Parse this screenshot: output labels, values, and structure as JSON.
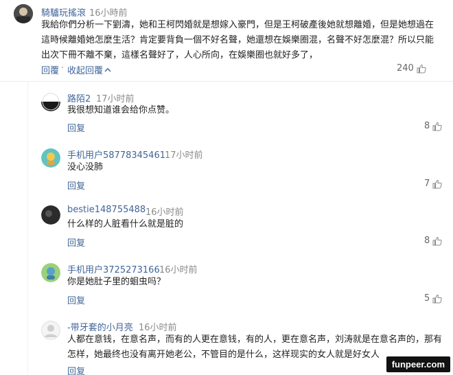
{
  "top_comment": {
    "username": "騎驢玩搖滾",
    "time": "16小時前",
    "text": "我給你們分析一下劉濤，她和王柯閃婚就是想嫁入豪門，但是王柯破產後她就想離婚，但是她想過在這時候離婚她怎麼生活？肯定要背負一個不好名聲，她還想在娛樂圈混，名聲不好怎麼混？所以只能出次下冊不離不棄，這樣名聲好了，人心所向，在娛樂圈也就好多了，",
    "reply_label": "回覆",
    "collapse_label": "收起回覆",
    "likes": "240"
  },
  "replies": [
    {
      "username": "路陌2",
      "time": "17小时前",
      "text": "我很想知道谁会给你点赞。",
      "reply_label": "回复",
      "likes": "8"
    },
    {
      "username": "手机用户58778345461",
      "time": "17小时前",
      "text": "没心没肺",
      "reply_label": "回复",
      "likes": "7"
    },
    {
      "username": "bestie148755488",
      "time": "16小时前",
      "text": "什么样的人脏看什么就是脏的",
      "reply_label": "回复",
      "likes": "8"
    },
    {
      "username": "手机用户3725273166",
      "time": "16小时前",
      "text": "你是她肚子里的蛔虫吗？",
      "reply_label": "回复",
      "likes": "5"
    },
    {
      "username": "-带牙套的小月亮",
      "time": "16小时前",
      "text": "人都在意钱，在意名声，而有的人更在意钱，有的人，更在意名声，刘涛就是在意名声的，那有怎样，她最终也没有离开她老公，不管目的是什么，这样现实的女人就是好女人",
      "reply_label": "回复",
      "likes": ""
    }
  ],
  "watermark": "funpeer.com",
  "colors": {
    "link": "#406599",
    "meta": "#8a8a8a"
  }
}
